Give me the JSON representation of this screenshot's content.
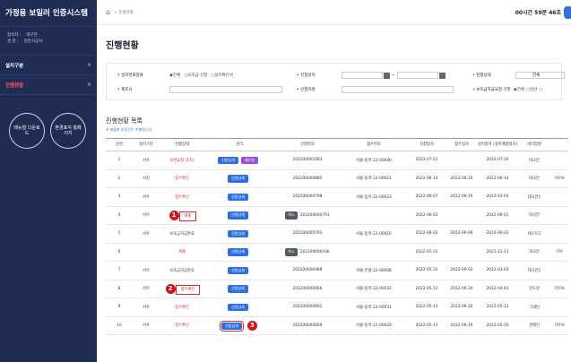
{
  "sidebar": {
    "brand": "가정용 보일러 인증시스템",
    "user_label_1": "접속자 :",
    "user_value_1": "대구안",
    "user_label_2": "권   한 :",
    "user_value_2": "일반시공사",
    "menu": [
      {
        "label": "설치구분",
        "active": false
      },
      {
        "label": "진행현황",
        "active": true
      }
    ],
    "circles": [
      {
        "label": "매뉴얼 다운로드"
      },
      {
        "label": "환경표지 홈페이지"
      }
    ]
  },
  "topbar": {
    "home_icon": "home-icon",
    "breadcrumb": "> 진행현황",
    "timer": "00시간 59분 46초"
  },
  "page": {
    "title": "진행현황"
  },
  "filters": {
    "row1": {
      "type_label": "• 설치연료종류",
      "type_options": [
        "◉전체",
        "○보조금 신청",
        "○설치확인서"
      ],
      "date_label": "• 신청일자",
      "status_label": "• 진행상태",
      "status_value": "전체"
    },
    "row2": {
      "maker_label": "• 제조사",
      "applicant_label": "• 신청자명",
      "subsidy_label": "• 보조금지급요청 구분",
      "subsidy_options": [
        "◉전체",
        "○일반",
        "○"
      ]
    }
  },
  "list": {
    "title": "진행현황 목록",
    "note": "※ 제출한 신청건이 조회됩니다.",
    "columns": [
      "순번",
      "설치구분",
      "진행상태",
      "관리",
      "신청번호",
      "접수번호",
      "신청일자",
      "접수일자",
      "설치일자 (설치예정일자)",
      "대리점명",
      ""
    ],
    "rows": [
      {
        "no": "1",
        "type": "서우",
        "status": "보완요청 (1차)",
        "status_class": "st-red",
        "buttons": [
          "신청상세",
          "재신청"
        ],
        "cancel": "",
        "app_no": "202200001093",
        "recv_no": "서울-동작-22-00040",
        "app_date": "2022-07-21",
        "recv_date": "",
        "inst_date": "2022-07-20",
        "agency": "대국안",
        "extra": ""
      },
      {
        "no": "2",
        "type": "서진",
        "status": "접수확인",
        "status_class": "st-pink",
        "buttons": [
          "신청상세"
        ],
        "cancel": "",
        "app_no": "202200000885",
        "recv_no": "서울-동작-22-00021",
        "app_date": "2022-06-14",
        "recv_date": "2022-06-20",
        "inst_date": "2022-06-14",
        "agency": "대국안",
        "extra": "거우보"
      },
      {
        "no": "3",
        "type": "서우",
        "status": "접수확인",
        "status_class": "st-pink",
        "buttons": [
          "신청상세"
        ],
        "cancel": "",
        "app_no": "202200000798",
        "recv_no": "서울-동작-22-00023",
        "app_date": "2022-06-07",
        "recv_date": "2022-06-20",
        "inst_date": "2022-03-03",
        "agency": "대국안1",
        "extra": ""
      },
      {
        "no": "4",
        "type": "서우",
        "status": "제출",
        "status_class": "st-pink",
        "buttons": [
          "신청상세"
        ],
        "cancel": "취소",
        "app_no": "202200000791",
        "recv_no": "",
        "app_date": "2022-06-02",
        "recv_date": "",
        "inst_date": "2022-06-01",
        "agency": "대국안",
        "extra": "",
        "marker": "1",
        "highlight": "status"
      },
      {
        "no": "5",
        "type": "서우",
        "status": "보조금지급완료",
        "status_class": "",
        "buttons": [
          "신청상세"
        ],
        "cancel": "",
        "app_no": "202200000793",
        "recv_no": "서울-동작-22-00016",
        "app_date": "2022-06-02",
        "recv_date": "2022-06-06",
        "inst_date": "2022-06-02",
        "agency": "테스트3",
        "extra": ""
      },
      {
        "no": "6",
        "type": "",
        "status": "제출",
        "status_class": "st-pink",
        "buttons": [
          "신청상세"
        ],
        "cancel": "취소",
        "app_no": "202200000436",
        "recv_no": "",
        "app_date": "2022-05-31",
        "recv_date": "",
        "inst_date": "2021-12-21",
        "agency": "대국안",
        "extra": "거우"
      },
      {
        "no": "7",
        "type": "서우",
        "status": "보조금지급완료",
        "status_class": "",
        "buttons": [
          "신청상세"
        ],
        "cancel": "",
        "app_no": "202200000488",
        "recv_no": "서울-은평-22-00008",
        "app_date": "2022-05-31",
        "recv_date": "2022-06-02",
        "inst_date": "2022-03-03",
        "agency": "대국안1",
        "extra": ""
      },
      {
        "no": "8",
        "type": "서우",
        "status": "접수확인",
        "status_class": "st-pink",
        "buttons": [
          "신청상세"
        ],
        "cancel": "",
        "app_no": "202200000666",
        "recv_no": "서울-동작-22-00032",
        "app_date": "2022-05-13",
        "recv_date": "2022-06-20",
        "inst_date": "2022-04-01",
        "agency": "선도원",
        "extra": "거우보",
        "marker": "2",
        "highlight": "status"
      },
      {
        "no": "9",
        "type": "서우",
        "status": "접수확인",
        "status_class": "st-pink",
        "buttons": [
          "신청상세"
        ],
        "cancel": "",
        "app_no": "202200000662",
        "recv_no": "서울-동작-22-00031",
        "app_date": "2022-05-13",
        "recv_date": "2022-06-20",
        "inst_date": "2022-05-12",
        "agency": "그대린",
        "extra": ""
      },
      {
        "no": "10",
        "type": "서우",
        "status": "접수확인",
        "status_class": "st-pink",
        "buttons": [
          "신청상세"
        ],
        "cancel": "",
        "app_no": "202200000669",
        "recv_no": "서울-동작-22-00029",
        "app_date": "2022-05-13",
        "recv_date": "2022-06-20",
        "inst_date": "2022-05-20",
        "agency": "권혜인",
        "extra": "거우보",
        "marker": "3",
        "highlight": "button"
      }
    ]
  }
}
